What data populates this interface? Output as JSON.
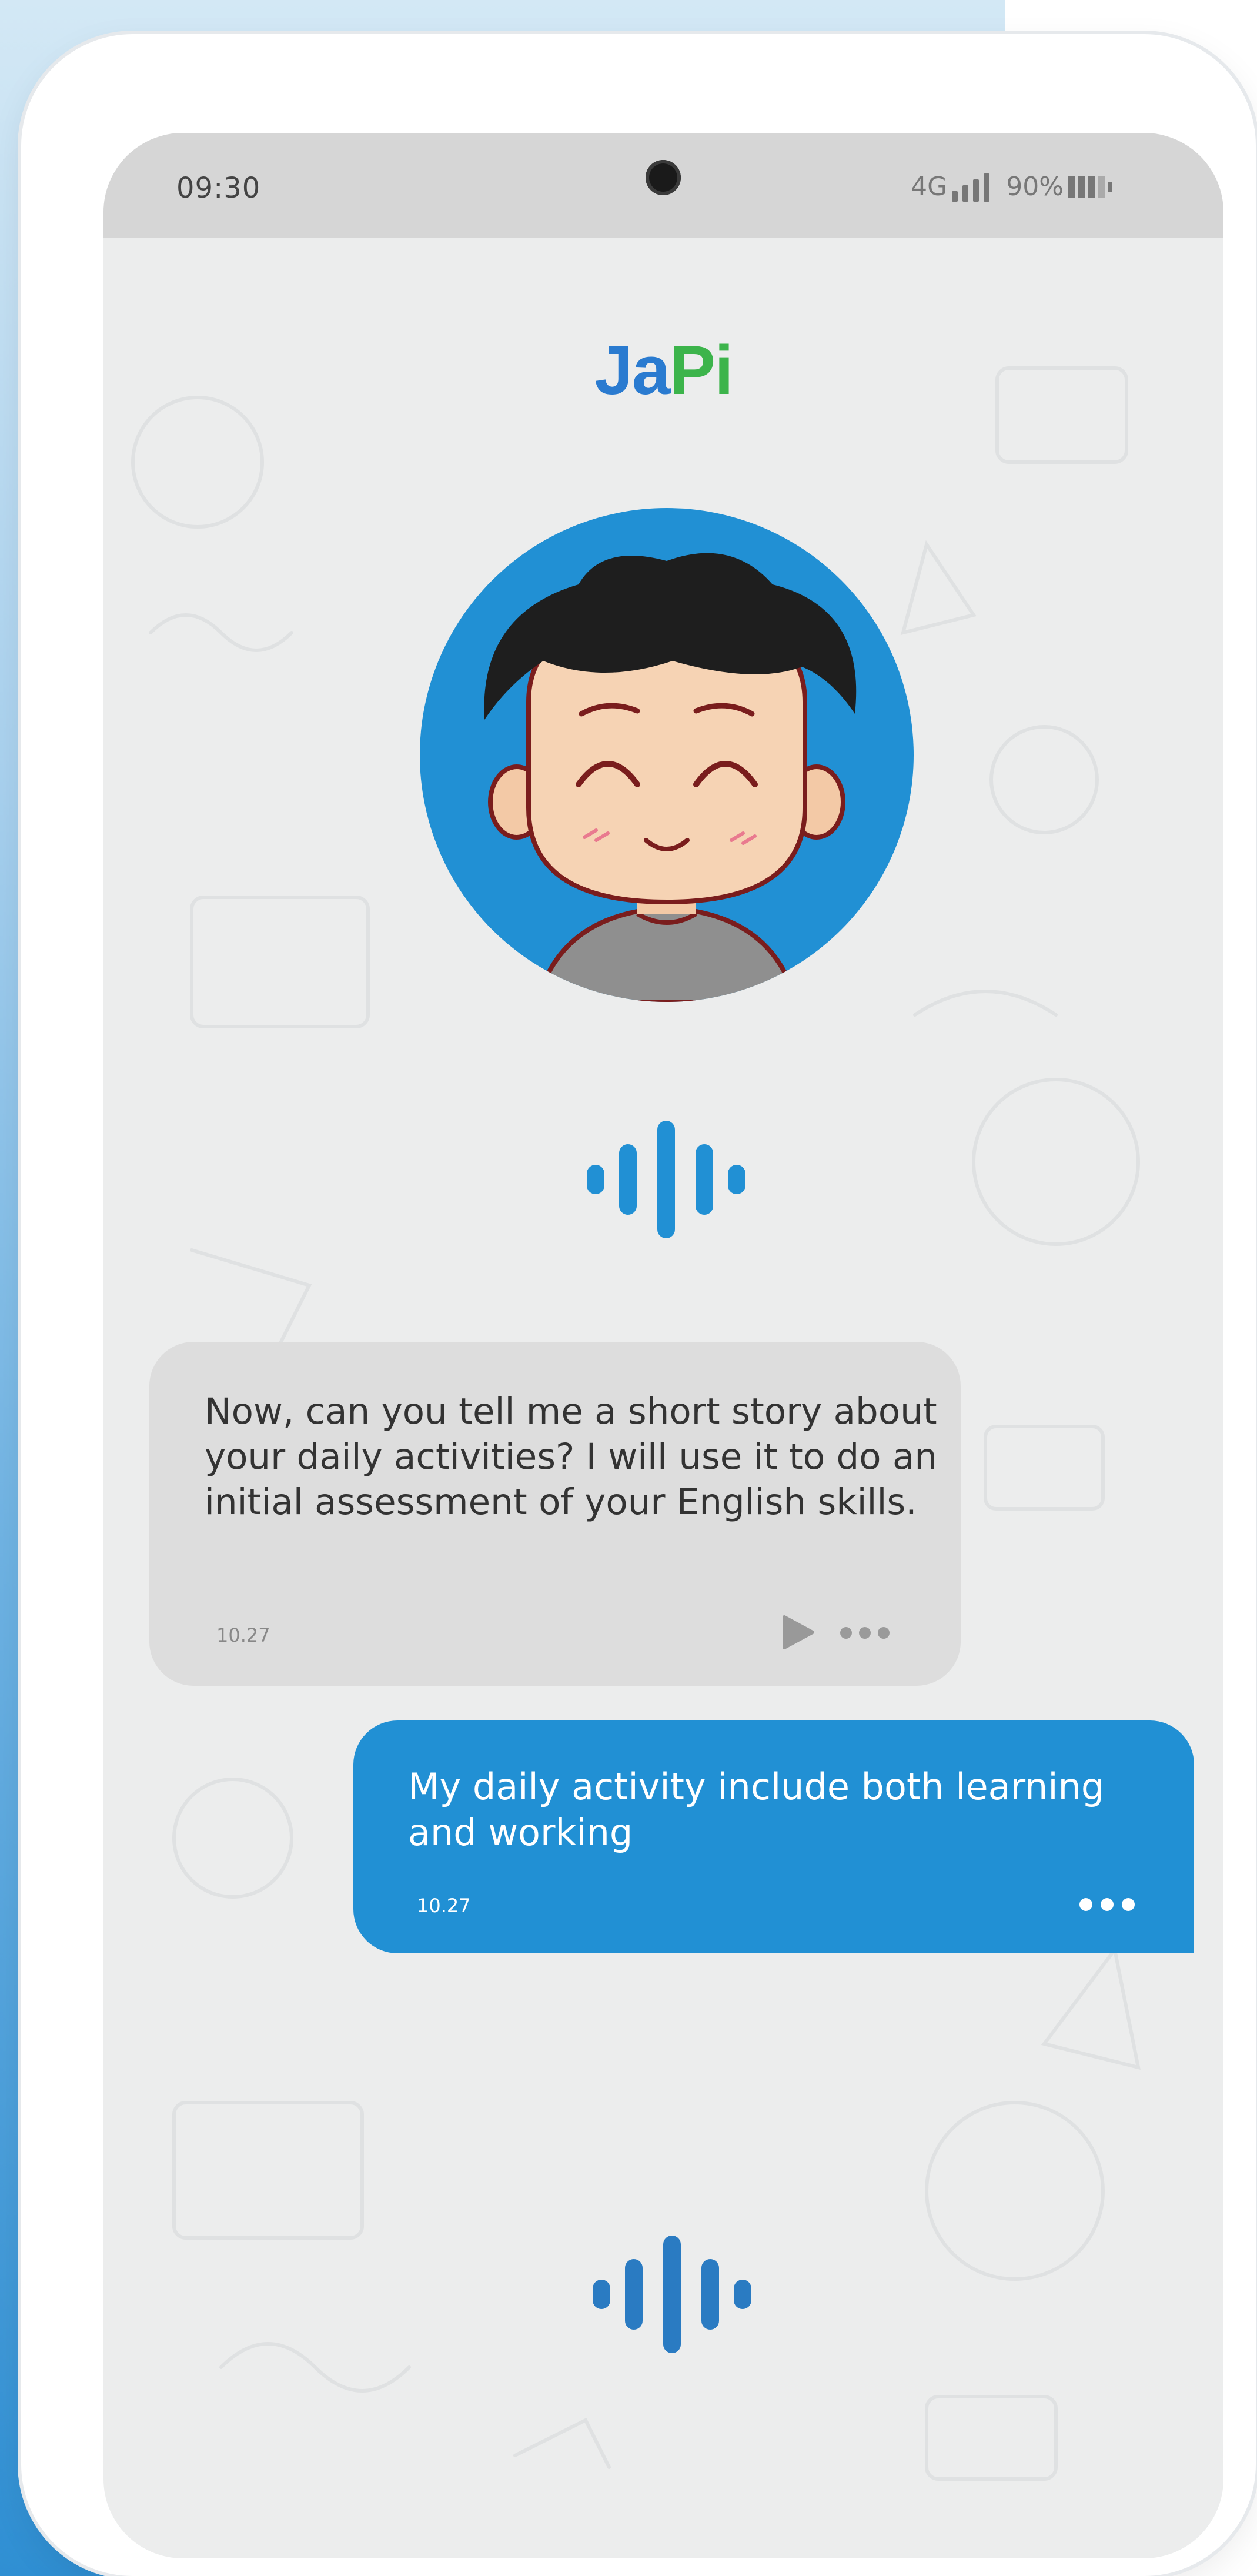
{
  "status_bar": {
    "time": "09:30",
    "network": "4G",
    "battery": "90%"
  },
  "app": {
    "logo_part1": "Ja",
    "logo_part2": "Pi"
  },
  "colors": {
    "brand_blue": "#2190d4",
    "logo_green": "#3cb44b"
  },
  "messages": [
    {
      "sender": "bot",
      "text": "Now, can you tell me a short story about your daily activities? I will use it to do an initial assessment of your English skills.",
      "time": "10.27"
    },
    {
      "sender": "user",
      "text": "My daily activity include both learning and working",
      "time": "10.27"
    }
  ],
  "icons": {
    "voice_top": "voice-wave-icon",
    "voice_bottom": "microphone-wave-icon",
    "play": "play-icon",
    "more": "more-dots-icon"
  }
}
